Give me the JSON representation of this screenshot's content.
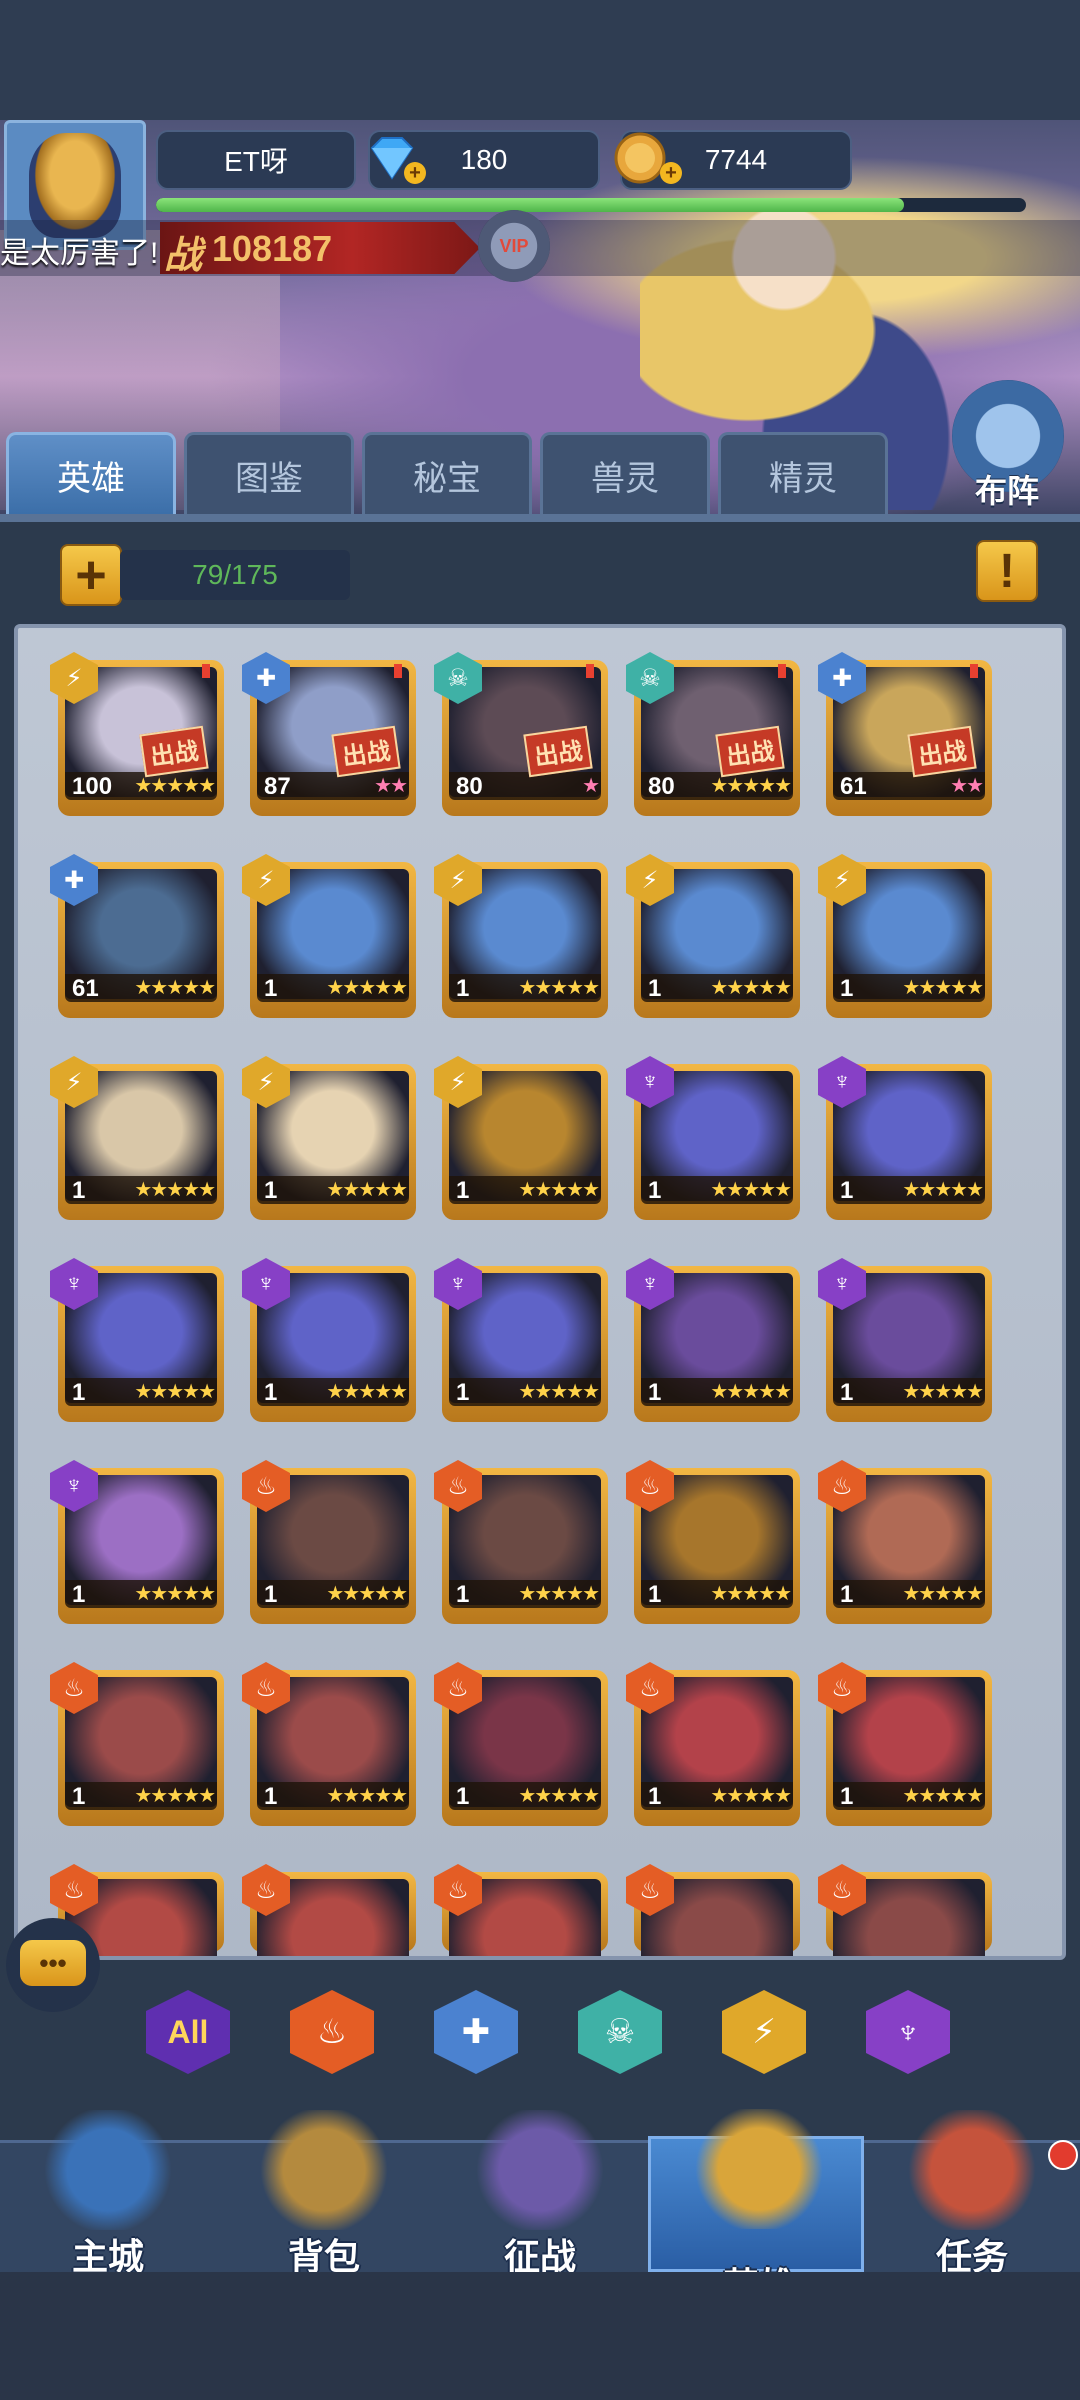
{
  "player": {
    "name": "ET呀",
    "gems": "180",
    "gold": "7744",
    "power_label": "战",
    "power": "108187",
    "vip": "VIP",
    "xp_fraction": 0.86
  },
  "ticker": {
    "message": "是太厉害了!"
  },
  "tabs": [
    {
      "label": "英雄"
    },
    {
      "label": "图鉴"
    },
    {
      "label": "秘宝"
    },
    {
      "label": "兽灵"
    },
    {
      "label": "精灵"
    }
  ],
  "deploy_button": {
    "label": "布阵"
  },
  "hero_count": "79/175",
  "deploy_badge": "出战",
  "heroes": [
    {
      "level": "100",
      "stars": "★★★★★",
      "pink": false,
      "faction": "light",
      "deployed": true,
      "color": "#c8c2d8"
    },
    {
      "level": "87",
      "stars": "★★",
      "pink": true,
      "faction": "water",
      "deployed": true,
      "color": "#8f9ec8"
    },
    {
      "level": "80",
      "stars": "★",
      "pink": true,
      "faction": "skull",
      "deployed": true,
      "color": "#5d4b55"
    },
    {
      "level": "80",
      "stars": "★★★★★",
      "pink": false,
      "faction": "skull",
      "deployed": true,
      "color": "#6f6070"
    },
    {
      "level": "61",
      "stars": "★★",
      "pink": true,
      "faction": "water",
      "deployed": true,
      "color": "#c9a65b"
    },
    {
      "level": "61",
      "stars": "★★★★★",
      "pink": false,
      "faction": "water",
      "deployed": false,
      "color": "#4c6c92"
    },
    {
      "level": "1",
      "stars": "★★★★★",
      "pink": false,
      "faction": "light",
      "deployed": false,
      "color": "#5a8ad0"
    },
    {
      "level": "1",
      "stars": "★★★★★",
      "pink": false,
      "faction": "light",
      "deployed": false,
      "color": "#5a8ad0"
    },
    {
      "level": "1",
      "stars": "★★★★★",
      "pink": false,
      "faction": "light",
      "deployed": false,
      "color": "#5a8ad0"
    },
    {
      "level": "1",
      "stars": "★★★★★",
      "pink": false,
      "faction": "light",
      "deployed": false,
      "color": "#5a8ad0"
    },
    {
      "level": "1",
      "stars": "★★★★★",
      "pink": false,
      "faction": "light",
      "deployed": false,
      "color": "#d9c7a8"
    },
    {
      "level": "1",
      "stars": "★★★★★",
      "pink": false,
      "faction": "light",
      "deployed": false,
      "color": "#e6d3b2"
    },
    {
      "level": "1",
      "stars": "★★★★★",
      "pink": false,
      "faction": "light",
      "deployed": false,
      "color": "#b8862f"
    },
    {
      "level": "1",
      "stars": "★★★★★",
      "pink": false,
      "faction": "dark",
      "deployed": false,
      "color": "#5f63c8"
    },
    {
      "level": "1",
      "stars": "★★★★★",
      "pink": false,
      "faction": "dark",
      "deployed": false,
      "color": "#5f63c8"
    },
    {
      "level": "1",
      "stars": "★★★★★",
      "pink": false,
      "faction": "dark",
      "deployed": false,
      "color": "#5f63c8"
    },
    {
      "level": "1",
      "stars": "★★★★★",
      "pink": false,
      "faction": "dark",
      "deployed": false,
      "color": "#5f63c8"
    },
    {
      "level": "1",
      "stars": "★★★★★",
      "pink": false,
      "faction": "dark",
      "deployed": false,
      "color": "#5f63c8"
    },
    {
      "level": "1",
      "stars": "★★★★★",
      "pink": false,
      "faction": "dark",
      "deployed": false,
      "color": "#6a4c9c"
    },
    {
      "level": "1",
      "stars": "★★★★★",
      "pink": false,
      "faction": "dark",
      "deployed": false,
      "color": "#6a4c9c"
    },
    {
      "level": "1",
      "stars": "★★★★★",
      "pink": false,
      "faction": "dark",
      "deployed": false,
      "color": "#9c6fc4"
    },
    {
      "level": "1",
      "stars": "★★★★★",
      "pink": false,
      "faction": "fire",
      "deployed": false,
      "color": "#6b4a44"
    },
    {
      "level": "1",
      "stars": "★★★★★",
      "pink": false,
      "faction": "fire",
      "deployed": false,
      "color": "#6b4a44"
    },
    {
      "level": "1",
      "stars": "★★★★★",
      "pink": false,
      "faction": "fire",
      "deployed": false,
      "color": "#a7762c"
    },
    {
      "level": "1",
      "stars": "★★★★★",
      "pink": false,
      "faction": "fire",
      "deployed": false,
      "color": "#b06a55"
    },
    {
      "level": "1",
      "stars": "★★★★★",
      "pink": false,
      "faction": "fire",
      "deployed": false,
      "color": "#9b4b4a"
    },
    {
      "level": "1",
      "stars": "★★★★★",
      "pink": false,
      "faction": "fire",
      "deployed": false,
      "color": "#9b4b4a"
    },
    {
      "level": "1",
      "stars": "★★★★★",
      "pink": false,
      "faction": "fire",
      "deployed": false,
      "color": "#7a3548"
    },
    {
      "level": "1",
      "stars": "★★★★★",
      "pink": false,
      "faction": "fire",
      "deployed": false,
      "color": "#b3424a"
    },
    {
      "level": "1",
      "stars": "★★★★★",
      "pink": false,
      "faction": "fire",
      "deployed": false,
      "color": "#b3424a"
    },
    {
      "level": "",
      "stars": "",
      "pink": false,
      "faction": "fire",
      "deployed": false,
      "color": "#b24a45"
    },
    {
      "level": "",
      "stars": "",
      "pink": false,
      "faction": "fire",
      "deployed": false,
      "color": "#b24a45"
    },
    {
      "level": "",
      "stars": "",
      "pink": false,
      "faction": "fire",
      "deployed": false,
      "color": "#b24a45"
    },
    {
      "level": "",
      "stars": "",
      "pink": false,
      "faction": "fire",
      "deployed": false,
      "color": "#8a4a48"
    },
    {
      "level": "",
      "stars": "",
      "pink": false,
      "faction": "fire",
      "deployed": false,
      "color": "#8a4a48"
    }
  ],
  "faction_icons": {
    "light": "⚡",
    "water": "✚",
    "skull": "☠",
    "dark": "♆",
    "fire": "♨"
  },
  "filters": [
    {
      "name": "all",
      "label": "All",
      "color": "#5f2fb0"
    },
    {
      "name": "fire",
      "label": "♨",
      "color": "#e45d25"
    },
    {
      "name": "water",
      "label": "✚",
      "color": "#4b82d0"
    },
    {
      "name": "skull",
      "label": "☠",
      "color": "#3fb1a6"
    },
    {
      "name": "light",
      "label": "⚡",
      "color": "#e0a82a"
    },
    {
      "name": "dark",
      "label": "♆",
      "color": "#8740c6"
    }
  ],
  "chat_icon": "•••",
  "nav": [
    {
      "label": "主城",
      "color": "#3a72b8"
    },
    {
      "label": "背包",
      "color": "#b48a3e"
    },
    {
      "label": "征战",
      "color": "#6c5aa8"
    },
    {
      "label": "英雄",
      "color": "#d9a53a"
    },
    {
      "label": "任务",
      "color": "#c5533c"
    }
  ]
}
